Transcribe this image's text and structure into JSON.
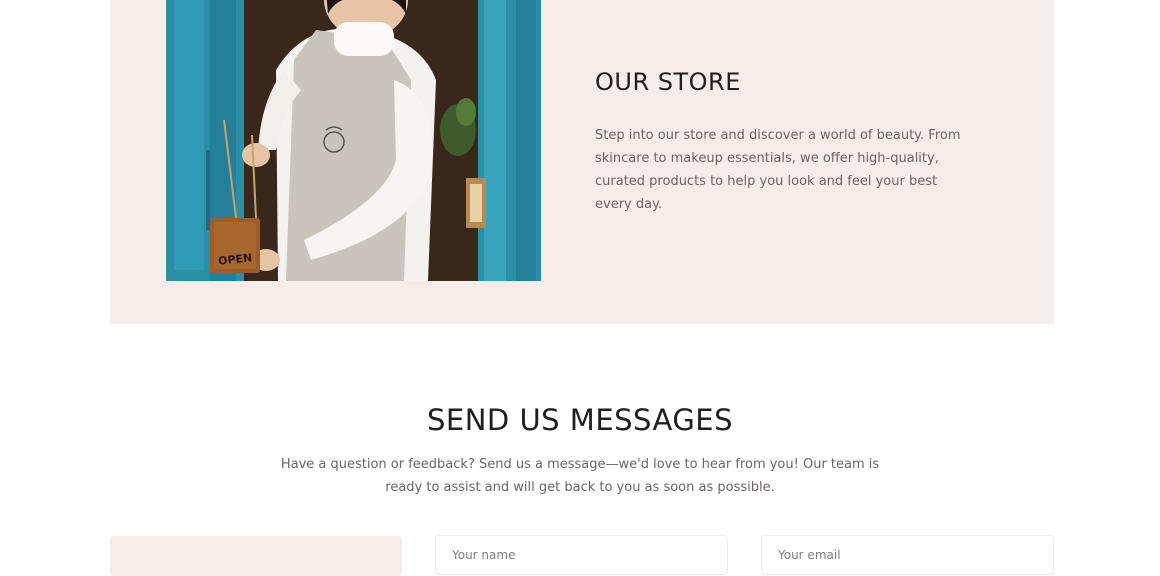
{
  "store": {
    "title": "OUR STORE",
    "description": "Step into our store and discover a world of beauty. From skincare to makeup essentials, we offer high-quality, curated products to help you look and feel your best every day.",
    "image_sign_text": "OPEN"
  },
  "messages": {
    "title": "SEND US MESSAGES",
    "description": "Have a question or feedback? Send us a message—we'd love to hear from you! Our team is ready to assist and will get back to you as soon as possible."
  },
  "form": {
    "name_placeholder": "Your name",
    "email_placeholder": "Your email"
  },
  "colors": {
    "section_background": "#f6ecea",
    "door_teal": "#2b8fa8",
    "text_dark": "#1f1f1f",
    "text_muted": "#6b6462"
  }
}
